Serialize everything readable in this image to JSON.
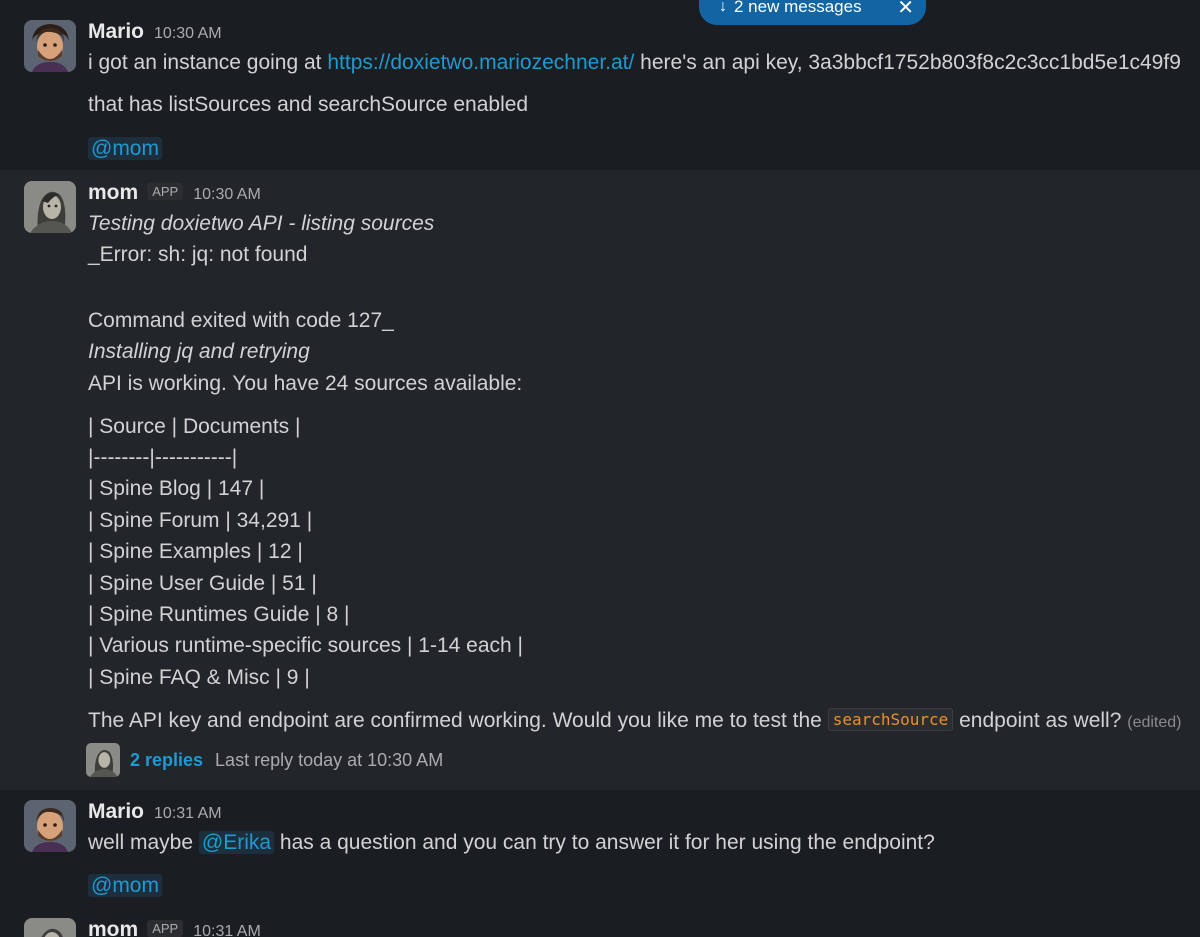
{
  "banner": {
    "arrow_icon": "↓",
    "label": "2 new messages",
    "close_icon": "✕"
  },
  "messages": [
    {
      "author": "Mario",
      "time": "10:30 AM",
      "avatar_icon": "mario-avatar",
      "text_start": "i got an instance going at ",
      "link": "https://doxietwo.mariozechner.at/",
      "text_end": " here's an api key, 3a3bbcf1752b803f8c2c3cc1bd5e1c49f9",
      "line2": "that has listSources and searchSource enabled",
      "mention": "@mom"
    },
    {
      "author": "mom",
      "badge": "APP",
      "time": "10:30 AM",
      "avatar_icon": "mom-bot-avatar",
      "lines": [
        "Testing doxietwo API - listing sources",
        "_Error: sh: jq: not found",
        "Command exited with code 127_",
        "Installing jq and retrying",
        "API is working. You have 24 sources available:",
        "| Source | Documents |",
        "|--------|-----------|",
        "| Spine Blog | 147 |",
        "| Spine Forum | 34,291 |",
        "| Spine Examples | 12 |",
        "| Spine User Guide | 51 |",
        "| Spine Runtimes Guide | 8 |",
        "| Various runtime-specific sources | 1-14 each |",
        "| Spine FAQ & Misc | 9 |"
      ],
      "final_start": "The API key and endpoint are confirmed working. Would you like me to test the ",
      "final_code": "searchSource",
      "final_end": " endpoint as well? ",
      "edited": "(edited)",
      "thread": {
        "replies": "2 replies",
        "last_reply": "Last reply today at 10:30 AM"
      }
    },
    {
      "author": "Mario",
      "time": "10:31 AM",
      "text_start": "well maybe ",
      "mention_inline": "@Erika",
      "text_end": " has a question and you can try to answer it for her using the endpoint?",
      "mention": "@mom"
    },
    {
      "author": "mom",
      "badge": "APP",
      "time": "10:31 AM"
    }
  ]
}
